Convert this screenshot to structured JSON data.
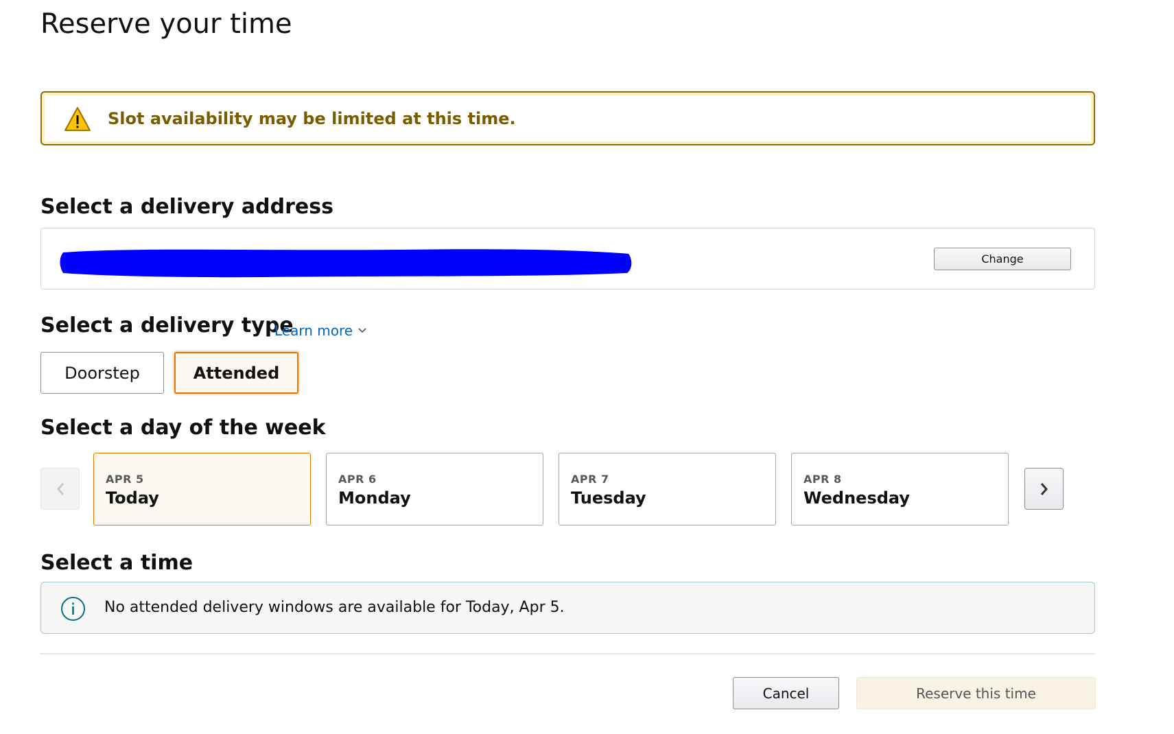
{
  "page": {
    "title": "Reserve your time"
  },
  "alert": {
    "icon": "warning-triangle-icon",
    "message": "Slot availability may be limited at this time."
  },
  "address": {
    "heading": "Select a delivery address",
    "change_label": "Change"
  },
  "delivery_type": {
    "heading": "Select a delivery type",
    "learn_more_label": "Learn more",
    "options": [
      {
        "label": "Doorstep",
        "selected": false
      },
      {
        "label": "Attended",
        "selected": true
      }
    ]
  },
  "day_select": {
    "heading": "Select a day of the week",
    "days": [
      {
        "date": "APR 5",
        "name": "Today",
        "selected": true
      },
      {
        "date": "APR 6",
        "name": "Monday",
        "selected": false
      },
      {
        "date": "APR 7",
        "name": "Tuesday",
        "selected": false
      },
      {
        "date": "APR 8",
        "name": "Wednesday",
        "selected": false
      }
    ]
  },
  "time_select": {
    "heading": "Select a time",
    "info_message": "No attended delivery windows are available for Today, Apr 5."
  },
  "footer": {
    "cancel_label": "Cancel",
    "reserve_label": "Reserve this time"
  },
  "colors": {
    "accent_orange": "#e77600",
    "alert_border": "#8c6e00",
    "link_blue": "#0066c0",
    "redaction_blue": "#0000ff"
  }
}
